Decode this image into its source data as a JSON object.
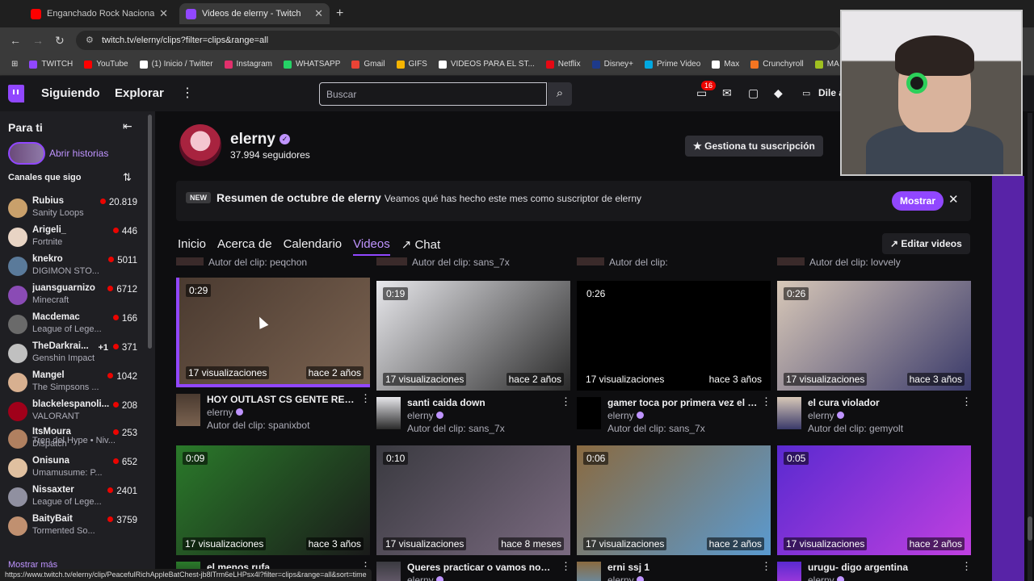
{
  "browser": {
    "tabs": [
      {
        "title": "Enganchado Rock Nacional Pa",
        "favicon_color": "#ff0000",
        "active": false
      },
      {
        "title": "Videos de elerny - Twitch",
        "favicon_color": "#9147ff",
        "active": true
      }
    ],
    "url": "twitch.tv/elerny/clips?filter=clips&range=all",
    "bookmarks": [
      {
        "label": "TWITCH",
        "color": "#9147ff"
      },
      {
        "label": "YouTube",
        "color": "#ff0000"
      },
      {
        "label": "(1) Inicio / Twitter",
        "color": "#ffffff"
      },
      {
        "label": "Instagram",
        "color": "#e1306c"
      },
      {
        "label": "WHATSAPP",
        "color": "#25d366"
      },
      {
        "label": "Gmail",
        "color": "#ea4335"
      },
      {
        "label": "GIFS",
        "color": "#f5b400"
      },
      {
        "label": "VIDEOS PARA EL ST...",
        "color": "#ffffff"
      },
      {
        "label": "Netflix",
        "color": "#e50914"
      },
      {
        "label": "Disney+",
        "color": "#1e3a8a"
      },
      {
        "label": "Prime Video",
        "color": "#00a8e1"
      },
      {
        "label": "Max",
        "color": "#ffffff"
      },
      {
        "label": "Crunchyroll",
        "color": "#f47521"
      },
      {
        "label": "MA",
        "color": "#a0c020"
      }
    ],
    "status_url": "https://www.twitch.tv/elerny/clip/PeacefulRichAppleBatChest-jb8lTrm6eLHPsx4l?filter=clips&range=all&sort=time"
  },
  "topnav": {
    "following": "Siguiendo",
    "browse": "Explorar",
    "search_placeholder": "Buscar",
    "notifications_count": "16",
    "user_label": "Dile a"
  },
  "sidebar": {
    "title": "Para ti",
    "stories_label": "Abrir historias",
    "followed_title": "Canales que sigo",
    "more": "Mostrar más",
    "channels": [
      {
        "name": "Rubius",
        "game": "Sanity Loops",
        "viewers": "20.819",
        "color": "#c9a06b"
      },
      {
        "name": "Arigeli_",
        "game": "Fortnite",
        "viewers": "446",
        "color": "#e8d4c4"
      },
      {
        "name": "knekro",
        "game": "DIGIMON STO...",
        "viewers": "5011",
        "color": "#5a7a9a"
      },
      {
        "name": "juansguarnizo",
        "game": "Minecraft",
        "viewers": "6712",
        "color": "#8a4bb5"
      },
      {
        "name": "Macdemac",
        "game": "League of Lege...",
        "viewers": "166",
        "color": "#6a6a6a"
      },
      {
        "name": "TheDarkrai...",
        "game": "Genshin Impact",
        "viewers": "371",
        "extra": "+1",
        "color": "#c0c0c0"
      },
      {
        "name": "Mangel",
        "game": "The Simpsons ...",
        "viewers": "1042",
        "color": "#d8b090"
      },
      {
        "name": "blackelespanoli...",
        "game": "VALORANT",
        "viewers": "208",
        "color": "#a0001a"
      },
      {
        "name": "ItsMoura",
        "game": "Dispatch",
        "viewers": "253",
        "color": "#b08060"
      },
      {
        "name": "Onisuna",
        "game": "Umamusume: P...",
        "viewers": "652",
        "color": "#e0c0a0"
      },
      {
        "name": "Nissaxter",
        "game": "League of Lege...",
        "viewers": "2401",
        "color": "#9090a0"
      },
      {
        "name": "BaityBait",
        "game": "Tormented So...",
        "viewers": "3759",
        "color": "#c09070"
      }
    ],
    "hype_train": "Tren del Hype • Niv..."
  },
  "channel": {
    "name": "elerny",
    "followers": "37.994 seguidores",
    "manage_sub": "Gestiona tu suscripción"
  },
  "banner": {
    "tag": "NEW",
    "title": "Resumen de octubre de elerny",
    "desc": "Veamos qué has hecho este mes como suscriptor de elerny",
    "button": "Mostrar"
  },
  "tabs": {
    "home": "Inicio",
    "about": "Acerca de",
    "schedule": "Calendario",
    "videos": "Videos",
    "chat": "Chat",
    "edit_videos": "Editar videos"
  },
  "prev_authors": [
    "Autor del clip: peqchon",
    "Autor del clip: sans_7x",
    "Autor del clip:",
    "Autor del clip: lovvely"
  ],
  "clips": [
    {
      "duration": "0:29",
      "views": "17 visualizaciones",
      "ago": "hace 2 años",
      "title": "HOY OUTLAST CS GENTE RELA...",
      "channel": "elerny",
      "author": "Autor del clip: spanixbot",
      "bg": "#4a3a30",
      "bg2": "#7a6250"
    },
    {
      "duration": "0:19",
      "views": "17 visualizaciones",
      "ago": "hace 2 años",
      "title": "santi caida down",
      "channel": "elerny",
      "author": "Autor del clip: sans_7x",
      "bg": "#e8e8ec",
      "bg2": "#2a2a2a"
    },
    {
      "duration": "0:26",
      "views": "17 visualizaciones",
      "ago": "hace 3 años",
      "title": "gamer toca por primera vez el p...",
      "channel": "elerny",
      "author": "Autor del clip: sans_7x",
      "bg": "#000000",
      "bg2": "#000000"
    },
    {
      "duration": "0:26",
      "views": "17 visualizaciones",
      "ago": "hace 3 años",
      "title": "el cura violador",
      "channel": "elerny",
      "author": "Autor del clip: gemyolt",
      "bg": "#d8c8b8",
      "bg2": "#3a3a6a"
    },
    {
      "duration": "0:09",
      "views": "17 visualizaciones",
      "ago": "hace 3 años",
      "title": "el menos rufa",
      "channel": "elerny",
      "author": "",
      "bg": "#2a7a2a",
      "bg2": "#1a1a1a"
    },
    {
      "duration": "0:10",
      "views": "17 visualizaciones",
      "ago": "hace 8 meses",
      "title": "Queres practicar o vamos nom...",
      "channel": "elerny",
      "author": "",
      "bg": "#3a3a40",
      "bg2": "#7a6a80"
    },
    {
      "duration": "0:06",
      "views": "17 visualizaciones",
      "ago": "hace 2 años",
      "title": "erni ssj 1",
      "channel": "elerny",
      "author": "",
      "bg": "#8a6a40",
      "bg2": "#5a9ad0"
    },
    {
      "duration": "0:05",
      "views": "17 visualizaciones",
      "ago": "hace 2 años",
      "title": "urugu- digo argentina",
      "channel": "elerny",
      "author": "",
      "bg": "#5a2ad0",
      "bg2": "#c040e0"
    }
  ],
  "colors": {
    "accent": "#9147ff",
    "accent_light": "#bf94ff",
    "live": "#eb0400",
    "bg": "#0e0e10"
  }
}
